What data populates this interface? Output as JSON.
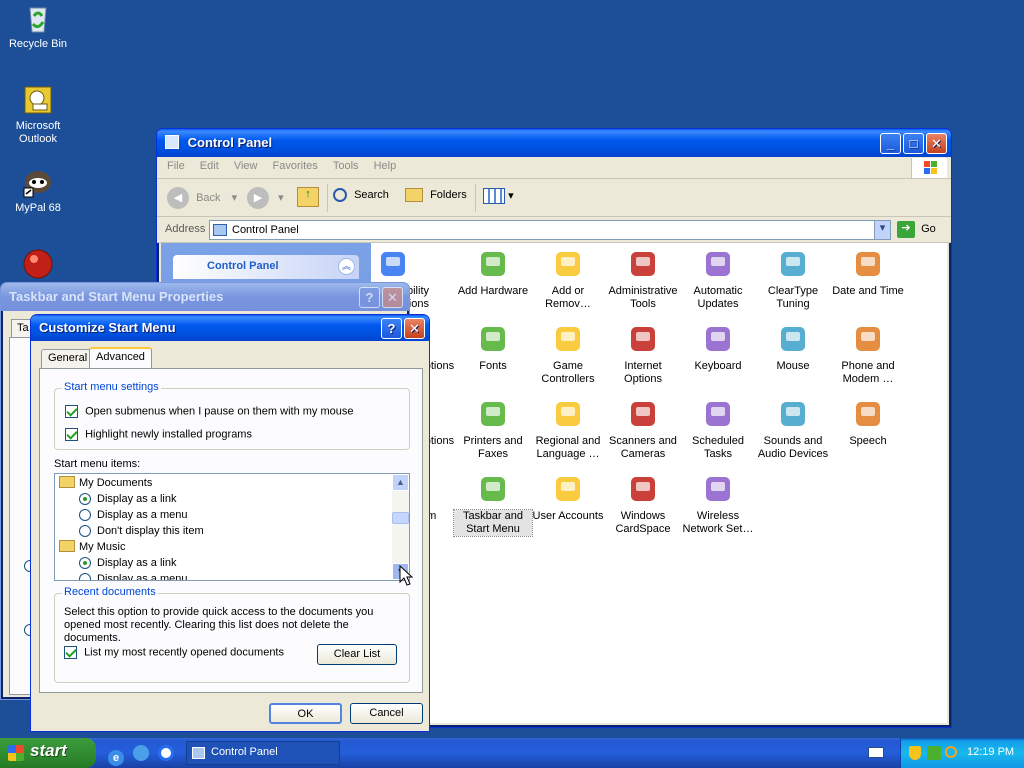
{
  "desktop": {
    "icons": [
      {
        "label": "Recycle Bin",
        "icon": "recycle-bin-icon"
      },
      {
        "label": "Microsoft Outlook",
        "icon": "outlook-icon"
      },
      {
        "label": "MyPal 68",
        "icon": "mypal-icon"
      }
    ]
  },
  "control_panel": {
    "title": "Control Panel",
    "menu": [
      "File",
      "Edit",
      "View",
      "Favorites",
      "Tools",
      "Help"
    ],
    "toolbar": {
      "back": "Back",
      "search": "Search",
      "folders": "Folders"
    },
    "address_label": "Address",
    "address_value": "Control Panel",
    "go": "Go",
    "left_panel_title": "Control Panel",
    "items": [
      {
        "label": "Accessibility Options",
        "partial": "ssibility\ntions",
        "icon": "accessibility-icon"
      },
      {
        "label": "Add Hardware",
        "icon": "add-hardware-icon"
      },
      {
        "label": "Add or Remov…",
        "icon": "add-remove-programs-icon"
      },
      {
        "label": "Administrative Tools",
        "icon": "administrative-tools-icon"
      },
      {
        "label": "Automatic Updates",
        "icon": "automatic-updates-icon"
      },
      {
        "label": "ClearType Tuning",
        "icon": "cleartype-icon"
      },
      {
        "label": "Date and Time",
        "icon": "date-time-icon"
      },
      {
        "label": "Folder Options",
        "icon": "folder-options-icon"
      },
      {
        "label": "Fonts",
        "icon": "fonts-icon"
      },
      {
        "label": "Game Controllers",
        "icon": "game-controllers-icon"
      },
      {
        "label": "Internet Options",
        "icon": "internet-options-icon"
      },
      {
        "label": "Keyboard",
        "icon": "keyboard-icon"
      },
      {
        "label": "Mouse",
        "icon": "mouse-icon"
      },
      {
        "label": "Phone and Modem …",
        "icon": "phone-modem-icon"
      },
      {
        "label": "Power Options",
        "icon": "power-options-icon"
      },
      {
        "label": "Printers and Faxes",
        "icon": "printers-faxes-icon"
      },
      {
        "label": "Regional and Language …",
        "icon": "regional-language-icon"
      },
      {
        "label": "Scanners and Cameras",
        "icon": "scanners-cameras-icon"
      },
      {
        "label": "Scheduled Tasks",
        "icon": "scheduled-tasks-icon"
      },
      {
        "label": "Sounds and Audio Devices",
        "icon": "sounds-icon"
      },
      {
        "label": "Speech",
        "icon": "speech-icon"
      },
      {
        "label": "System",
        "icon": "system-icon"
      },
      {
        "label": "Taskbar and Start Menu",
        "icon": "taskbar-start-menu-icon",
        "selected": true
      },
      {
        "label": "User Accounts",
        "icon": "user-accounts-icon"
      },
      {
        "label": "Windows CardSpace",
        "icon": "cardspace-icon"
      },
      {
        "label": "Wireless Network Set…",
        "icon": "wireless-network-icon"
      }
    ]
  },
  "taskbar_props": {
    "title": "Taskbar and Start Menu Properties",
    "tab_partial": "Ta"
  },
  "customize": {
    "title": "Customize Start Menu",
    "tabs": [
      "General",
      "Advanced"
    ],
    "settings_group": "Start menu settings",
    "settings": [
      {
        "label": "Open submenus when I pause on them with my mouse",
        "checked": true
      },
      {
        "label": "Highlight newly installed programs",
        "checked": true
      }
    ],
    "items_label": "Start menu items:",
    "tree": [
      {
        "type": "folder",
        "label": "My Documents"
      },
      {
        "type": "radio",
        "label": "Display as a link",
        "checked": true
      },
      {
        "type": "radio",
        "label": "Display as a menu",
        "checked": false
      },
      {
        "type": "radio",
        "label": "Don't display this item",
        "checked": false
      },
      {
        "type": "folder",
        "label": "My Music"
      },
      {
        "type": "radio",
        "label": "Display as a link",
        "checked": true
      },
      {
        "type": "radio",
        "label": "Display as a menu",
        "checked": false
      }
    ],
    "recent_group": "Recent documents",
    "recent_desc": "Select this option to provide quick access to the documents you opened most recently.  Clearing this list does not delete the documents.",
    "recent_check": "List my most recently opened documents",
    "clear_list": "Clear List",
    "ok": "OK",
    "cancel": "Cancel"
  },
  "taskbar": {
    "start": "start",
    "task": "Control Panel",
    "clock": "12:19 PM"
  }
}
